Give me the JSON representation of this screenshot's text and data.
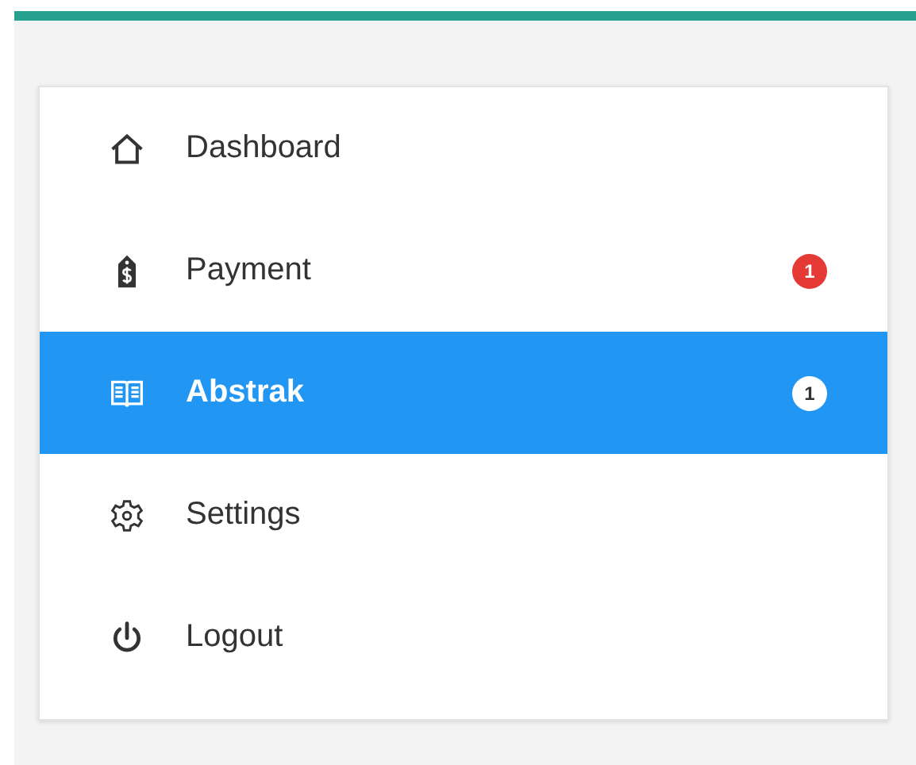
{
  "menu": {
    "items": [
      {
        "label": "Dashboard",
        "selected": false
      },
      {
        "label": "Payment",
        "selected": false,
        "badge": "1"
      },
      {
        "label": "Abstrak",
        "selected": true,
        "badge": "1"
      },
      {
        "label": "Settings",
        "selected": false
      },
      {
        "label": "Logout",
        "selected": false
      }
    ]
  }
}
